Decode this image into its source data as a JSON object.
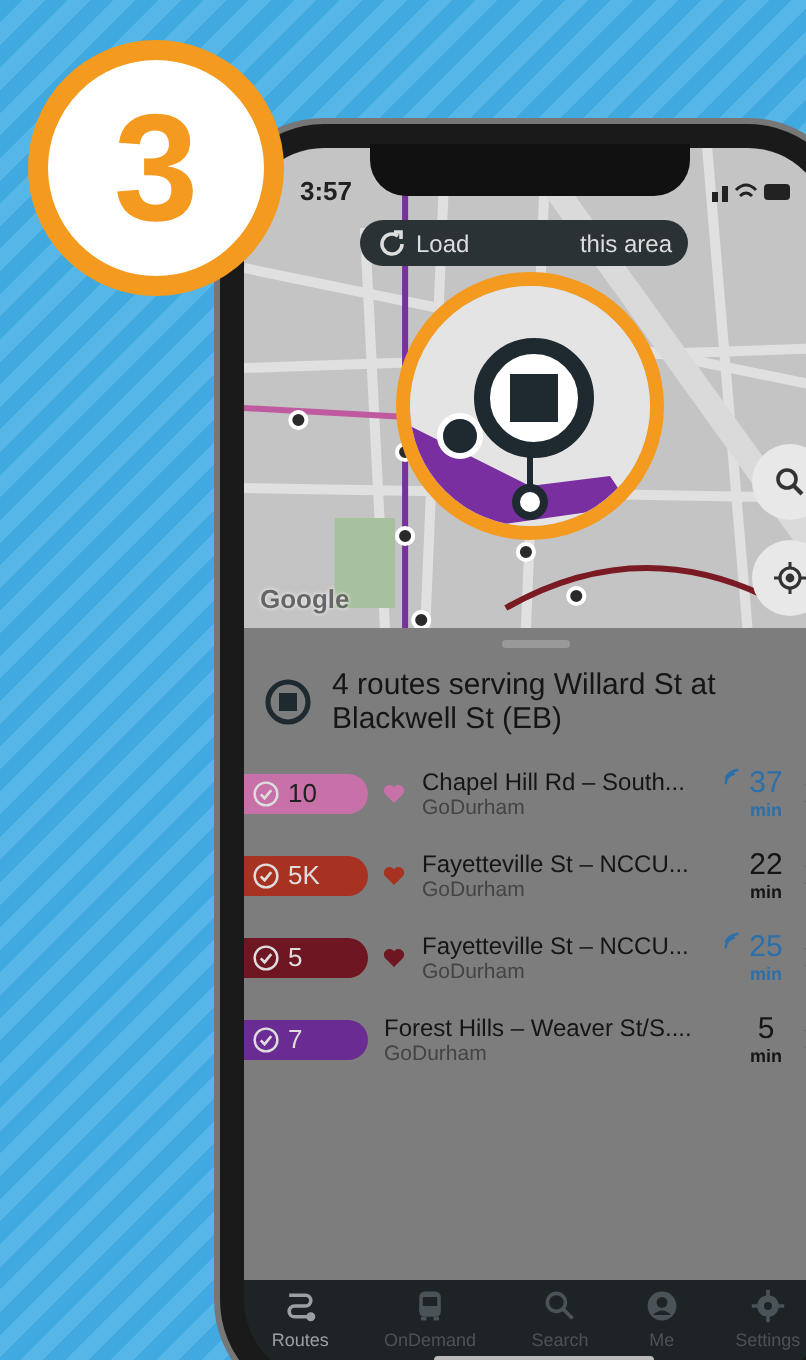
{
  "step_badge": {
    "number": "3"
  },
  "status_bar": {
    "time": "3:57"
  },
  "map": {
    "load_button": {
      "text_start": "Load",
      "text_end": "this area"
    },
    "attribution": "Google"
  },
  "sheet": {
    "title": "4 routes serving Willard St at Blackwell St (EB)",
    "routes": [
      {
        "number": "10",
        "color": "#c870a8",
        "favorite": true,
        "name": "Chapel Hill Rd – South...",
        "agency": "GoDurham",
        "minutes": "37",
        "unit": "min",
        "realtime": true
      },
      {
        "number": "5K",
        "color": "#a83222",
        "favorite": true,
        "name": "Fayetteville St – NCCU...",
        "agency": "GoDurham",
        "minutes": "22",
        "unit": "min",
        "realtime": false
      },
      {
        "number": "5",
        "color": "#6e1622",
        "favorite": true,
        "name": "Fayetteville St – NCCU...",
        "agency": "GoDurham",
        "minutes": "25",
        "unit": "min",
        "realtime": true
      },
      {
        "number": "7",
        "color": "#6a2c92",
        "favorite": false,
        "name": "Forest Hills – Weaver St/S....",
        "agency": "GoDurham",
        "minutes": "5",
        "unit": "min",
        "realtime": false
      }
    ]
  },
  "tab_bar": [
    {
      "label": "Routes",
      "selected": true
    },
    {
      "label": "OnDemand",
      "selected": false
    },
    {
      "label": "Search",
      "selected": false
    },
    {
      "label": "Me",
      "selected": false
    },
    {
      "label": "Settings",
      "selected": false
    }
  ]
}
